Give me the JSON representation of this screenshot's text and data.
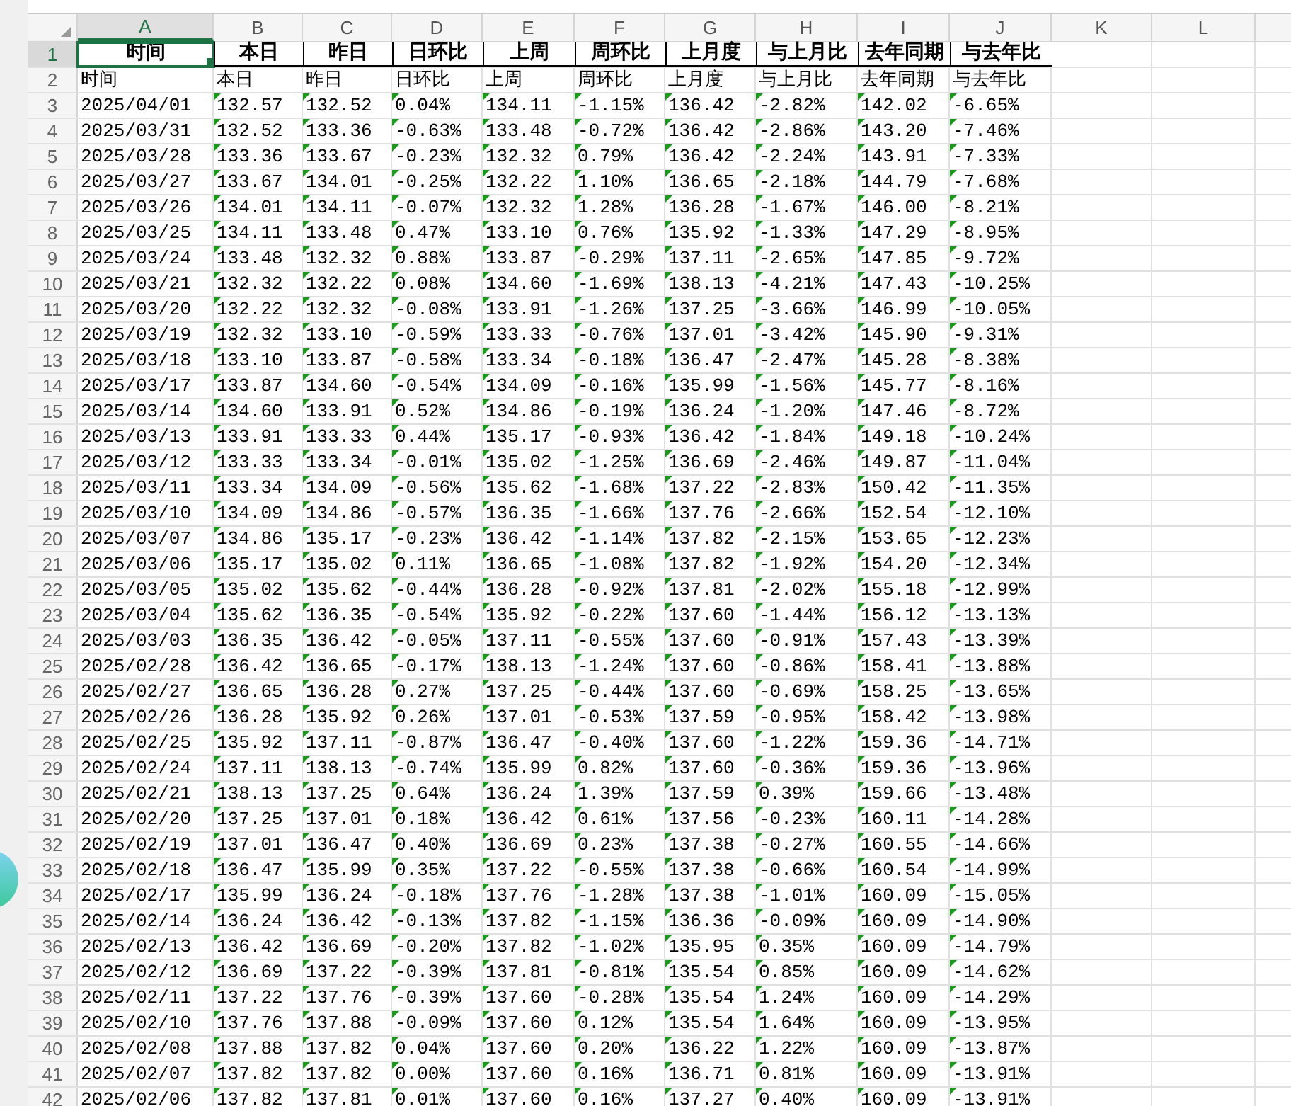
{
  "column_headers": [
    {
      "label": "A",
      "selected": true
    },
    {
      "label": "B",
      "selected": false
    },
    {
      "label": "C",
      "selected": false
    },
    {
      "label": "D",
      "selected": false
    },
    {
      "label": "E",
      "selected": false
    },
    {
      "label": "F",
      "selected": false
    },
    {
      "label": "G",
      "selected": false
    },
    {
      "label": "H",
      "selected": false
    },
    {
      "label": "I",
      "selected": false
    },
    {
      "label": "J",
      "selected": false
    },
    {
      "label": "K",
      "selected": false
    },
    {
      "label": "L",
      "selected": false
    }
  ],
  "rows": [
    {
      "number": "1",
      "selected": true,
      "kind": "header",
      "cells": [
        "时间",
        "本日",
        "昨日",
        "日环比",
        "上周",
        "周环比",
        "上月度",
        "与上月比",
        "去年同期",
        "与去年比"
      ]
    },
    {
      "number": "2",
      "selected": false,
      "kind": "plain",
      "cells": [
        "时间",
        "本日",
        "昨日",
        "日环比",
        "上周",
        "周环比",
        "上月度",
        "与上月比",
        "去年同期",
        "与去年比"
      ]
    },
    {
      "number": "3",
      "selected": false,
      "kind": "data",
      "cells": [
        "2025/04/01",
        "132.57",
        "132.52",
        "0.04%",
        "134.11",
        "-1.15%",
        "136.42",
        "-2.82%",
        "142.02",
        "-6.65%"
      ]
    },
    {
      "number": "4",
      "selected": false,
      "kind": "data",
      "cells": [
        "2025/03/31",
        "132.52",
        "133.36",
        "-0.63%",
        "133.48",
        "-0.72%",
        "136.42",
        "-2.86%",
        "143.20",
        "-7.46%"
      ]
    },
    {
      "number": "5",
      "selected": false,
      "kind": "data",
      "cells": [
        "2025/03/28",
        "133.36",
        "133.67",
        "-0.23%",
        "132.32",
        "0.79%",
        "136.42",
        "-2.24%",
        "143.91",
        "-7.33%"
      ]
    },
    {
      "number": "6",
      "selected": false,
      "kind": "data",
      "cells": [
        "2025/03/27",
        "133.67",
        "134.01",
        "-0.25%",
        "132.22",
        "1.10%",
        "136.65",
        "-2.18%",
        "144.79",
        "-7.68%"
      ]
    },
    {
      "number": "7",
      "selected": false,
      "kind": "data",
      "cells": [
        "2025/03/26",
        "134.01",
        "134.11",
        "-0.07%",
        "132.32",
        "1.28%",
        "136.28",
        "-1.67%",
        "146.00",
        "-8.21%"
      ]
    },
    {
      "number": "8",
      "selected": false,
      "kind": "data",
      "cells": [
        "2025/03/25",
        "134.11",
        "133.48",
        "0.47%",
        "133.10",
        "0.76%",
        "135.92",
        "-1.33%",
        "147.29",
        "-8.95%"
      ]
    },
    {
      "number": "9",
      "selected": false,
      "kind": "data",
      "cells": [
        "2025/03/24",
        "133.48",
        "132.32",
        "0.88%",
        "133.87",
        "-0.29%",
        "137.11",
        "-2.65%",
        "147.85",
        "-9.72%"
      ]
    },
    {
      "number": "10",
      "selected": false,
      "kind": "data",
      "cells": [
        "2025/03/21",
        "132.32",
        "132.22",
        "0.08%",
        "134.60",
        "-1.69%",
        "138.13",
        "-4.21%",
        "147.43",
        "-10.25%"
      ]
    },
    {
      "number": "11",
      "selected": false,
      "kind": "data",
      "cells": [
        "2025/03/20",
        "132.22",
        "132.32",
        "-0.08%",
        "133.91",
        "-1.26%",
        "137.25",
        "-3.66%",
        "146.99",
        "-10.05%"
      ]
    },
    {
      "number": "12",
      "selected": false,
      "kind": "data",
      "cells": [
        "2025/03/19",
        "132.32",
        "133.10",
        "-0.59%",
        "133.33",
        "-0.76%",
        "137.01",
        "-3.42%",
        "145.90",
        "-9.31%"
      ]
    },
    {
      "number": "13",
      "selected": false,
      "kind": "data",
      "cells": [
        "2025/03/18",
        "133.10",
        "133.87",
        "-0.58%",
        "133.34",
        "-0.18%",
        "136.47",
        "-2.47%",
        "145.28",
        "-8.38%"
      ]
    },
    {
      "number": "14",
      "selected": false,
      "kind": "data",
      "cells": [
        "2025/03/17",
        "133.87",
        "134.60",
        "-0.54%",
        "134.09",
        "-0.16%",
        "135.99",
        "-1.56%",
        "145.77",
        "-8.16%"
      ]
    },
    {
      "number": "15",
      "selected": false,
      "kind": "data",
      "cells": [
        "2025/03/14",
        "134.60",
        "133.91",
        "0.52%",
        "134.86",
        "-0.19%",
        "136.24",
        "-1.20%",
        "147.46",
        "-8.72%"
      ]
    },
    {
      "number": "16",
      "selected": false,
      "kind": "data",
      "cells": [
        "2025/03/13",
        "133.91",
        "133.33",
        "0.44%",
        "135.17",
        "-0.93%",
        "136.42",
        "-1.84%",
        "149.18",
        "-10.24%"
      ]
    },
    {
      "number": "17",
      "selected": false,
      "kind": "data",
      "cells": [
        "2025/03/12",
        "133.33",
        "133.34",
        "-0.01%",
        "135.02",
        "-1.25%",
        "136.69",
        "-2.46%",
        "149.87",
        "-11.04%"
      ]
    },
    {
      "number": "18",
      "selected": false,
      "kind": "data",
      "cells": [
        "2025/03/11",
        "133.34",
        "134.09",
        "-0.56%",
        "135.62",
        "-1.68%",
        "137.22",
        "-2.83%",
        "150.42",
        "-11.35%"
      ]
    },
    {
      "number": "19",
      "selected": false,
      "kind": "data",
      "cells": [
        "2025/03/10",
        "134.09",
        "134.86",
        "-0.57%",
        "136.35",
        "-1.66%",
        "137.76",
        "-2.66%",
        "152.54",
        "-12.10%"
      ]
    },
    {
      "number": "20",
      "selected": false,
      "kind": "data",
      "cells": [
        "2025/03/07",
        "134.86",
        "135.17",
        "-0.23%",
        "136.42",
        "-1.14%",
        "137.82",
        "-2.15%",
        "153.65",
        "-12.23%"
      ]
    },
    {
      "number": "21",
      "selected": false,
      "kind": "data",
      "cells": [
        "2025/03/06",
        "135.17",
        "135.02",
        "0.11%",
        "136.65",
        "-1.08%",
        "137.82",
        "-1.92%",
        "154.20",
        "-12.34%"
      ]
    },
    {
      "number": "22",
      "selected": false,
      "kind": "data",
      "cells": [
        "2025/03/05",
        "135.02",
        "135.62",
        "-0.44%",
        "136.28",
        "-0.92%",
        "137.81",
        "-2.02%",
        "155.18",
        "-12.99%"
      ]
    },
    {
      "number": "23",
      "selected": false,
      "kind": "data",
      "cells": [
        "2025/03/04",
        "135.62",
        "136.35",
        "-0.54%",
        "135.92",
        "-0.22%",
        "137.60",
        "-1.44%",
        "156.12",
        "-13.13%"
      ]
    },
    {
      "number": "24",
      "selected": false,
      "kind": "data",
      "cells": [
        "2025/03/03",
        "136.35",
        "136.42",
        "-0.05%",
        "137.11",
        "-0.55%",
        "137.60",
        "-0.91%",
        "157.43",
        "-13.39%"
      ]
    },
    {
      "number": "25",
      "selected": false,
      "kind": "data",
      "cells": [
        "2025/02/28",
        "136.42",
        "136.65",
        "-0.17%",
        "138.13",
        "-1.24%",
        "137.60",
        "-0.86%",
        "158.41",
        "-13.88%"
      ]
    },
    {
      "number": "26",
      "selected": false,
      "kind": "data",
      "cells": [
        "2025/02/27",
        "136.65",
        "136.28",
        "0.27%",
        "137.25",
        "-0.44%",
        "137.60",
        "-0.69%",
        "158.25",
        "-13.65%"
      ]
    },
    {
      "number": "27",
      "selected": false,
      "kind": "data",
      "cells": [
        "2025/02/26",
        "136.28",
        "135.92",
        "0.26%",
        "137.01",
        "-0.53%",
        "137.59",
        "-0.95%",
        "158.42",
        "-13.98%"
      ]
    },
    {
      "number": "28",
      "selected": false,
      "kind": "data",
      "cells": [
        "2025/02/25",
        "135.92",
        "137.11",
        "-0.87%",
        "136.47",
        "-0.40%",
        "137.60",
        "-1.22%",
        "159.36",
        "-14.71%"
      ]
    },
    {
      "number": "29",
      "selected": false,
      "kind": "data",
      "cells": [
        "2025/02/24",
        "137.11",
        "138.13",
        "-0.74%",
        "135.99",
        "0.82%",
        "137.60",
        "-0.36%",
        "159.36",
        "-13.96%"
      ]
    },
    {
      "number": "30",
      "selected": false,
      "kind": "data",
      "cells": [
        "2025/02/21",
        "138.13",
        "137.25",
        "0.64%",
        "136.24",
        "1.39%",
        "137.59",
        "0.39%",
        "159.66",
        "-13.48%"
      ]
    },
    {
      "number": "31",
      "selected": false,
      "kind": "data",
      "cells": [
        "2025/02/20",
        "137.25",
        "137.01",
        "0.18%",
        "136.42",
        "0.61%",
        "137.56",
        "-0.23%",
        "160.11",
        "-14.28%"
      ]
    },
    {
      "number": "32",
      "selected": false,
      "kind": "data",
      "cells": [
        "2025/02/19",
        "137.01",
        "136.47",
        "0.40%",
        "136.69",
        "0.23%",
        "137.38",
        "-0.27%",
        "160.55",
        "-14.66%"
      ]
    },
    {
      "number": "33",
      "selected": false,
      "kind": "data",
      "cells": [
        "2025/02/18",
        "136.47",
        "135.99",
        "0.35%",
        "137.22",
        "-0.55%",
        "137.38",
        "-0.66%",
        "160.54",
        "-14.99%"
      ]
    },
    {
      "number": "34",
      "selected": false,
      "kind": "data",
      "cells": [
        "2025/02/17",
        "135.99",
        "136.24",
        "-0.18%",
        "137.76",
        "-1.28%",
        "137.38",
        "-1.01%",
        "160.09",
        "-15.05%"
      ]
    },
    {
      "number": "35",
      "selected": false,
      "kind": "data",
      "cells": [
        "2025/02/14",
        "136.24",
        "136.42",
        "-0.13%",
        "137.82",
        "-1.15%",
        "136.36",
        "-0.09%",
        "160.09",
        "-14.90%"
      ]
    },
    {
      "number": "36",
      "selected": false,
      "kind": "data",
      "cells": [
        "2025/02/13",
        "136.42",
        "136.69",
        "-0.20%",
        "137.82",
        "-1.02%",
        "135.95",
        "0.35%",
        "160.09",
        "-14.79%"
      ]
    },
    {
      "number": "37",
      "selected": false,
      "kind": "data",
      "cells": [
        "2025/02/12",
        "136.69",
        "137.22",
        "-0.39%",
        "137.81",
        "-0.81%",
        "135.54",
        "0.85%",
        "160.09",
        "-14.62%"
      ]
    },
    {
      "number": "38",
      "selected": false,
      "kind": "data",
      "cells": [
        "2025/02/11",
        "137.22",
        "137.76",
        "-0.39%",
        "137.60",
        "-0.28%",
        "135.54",
        "1.24%",
        "160.09",
        "-14.29%"
      ]
    },
    {
      "number": "39",
      "selected": false,
      "kind": "data",
      "cells": [
        "2025/02/10",
        "137.76",
        "137.88",
        "-0.09%",
        "137.60",
        "0.12%",
        "135.54",
        "1.64%",
        "160.09",
        "-13.95%"
      ]
    },
    {
      "number": "40",
      "selected": false,
      "kind": "data",
      "cells": [
        "2025/02/08",
        "137.88",
        "137.82",
        "0.04%",
        "137.60",
        "0.20%",
        "136.22",
        "1.22%",
        "160.09",
        "-13.87%"
      ]
    },
    {
      "number": "41",
      "selected": false,
      "kind": "data",
      "cells": [
        "2025/02/07",
        "137.82",
        "137.82",
        "0.00%",
        "137.60",
        "0.16%",
        "136.71",
        "0.81%",
        "160.09",
        "-13.91%"
      ]
    },
    {
      "number": "42",
      "selected": false,
      "kind": "data",
      "cells": [
        "2025/02/06",
        "137.82",
        "137.81",
        "0.01%",
        "137.60",
        "0.16%",
        "137.27",
        "0.40%",
        "160.09",
        "-13.91%"
      ]
    }
  ]
}
